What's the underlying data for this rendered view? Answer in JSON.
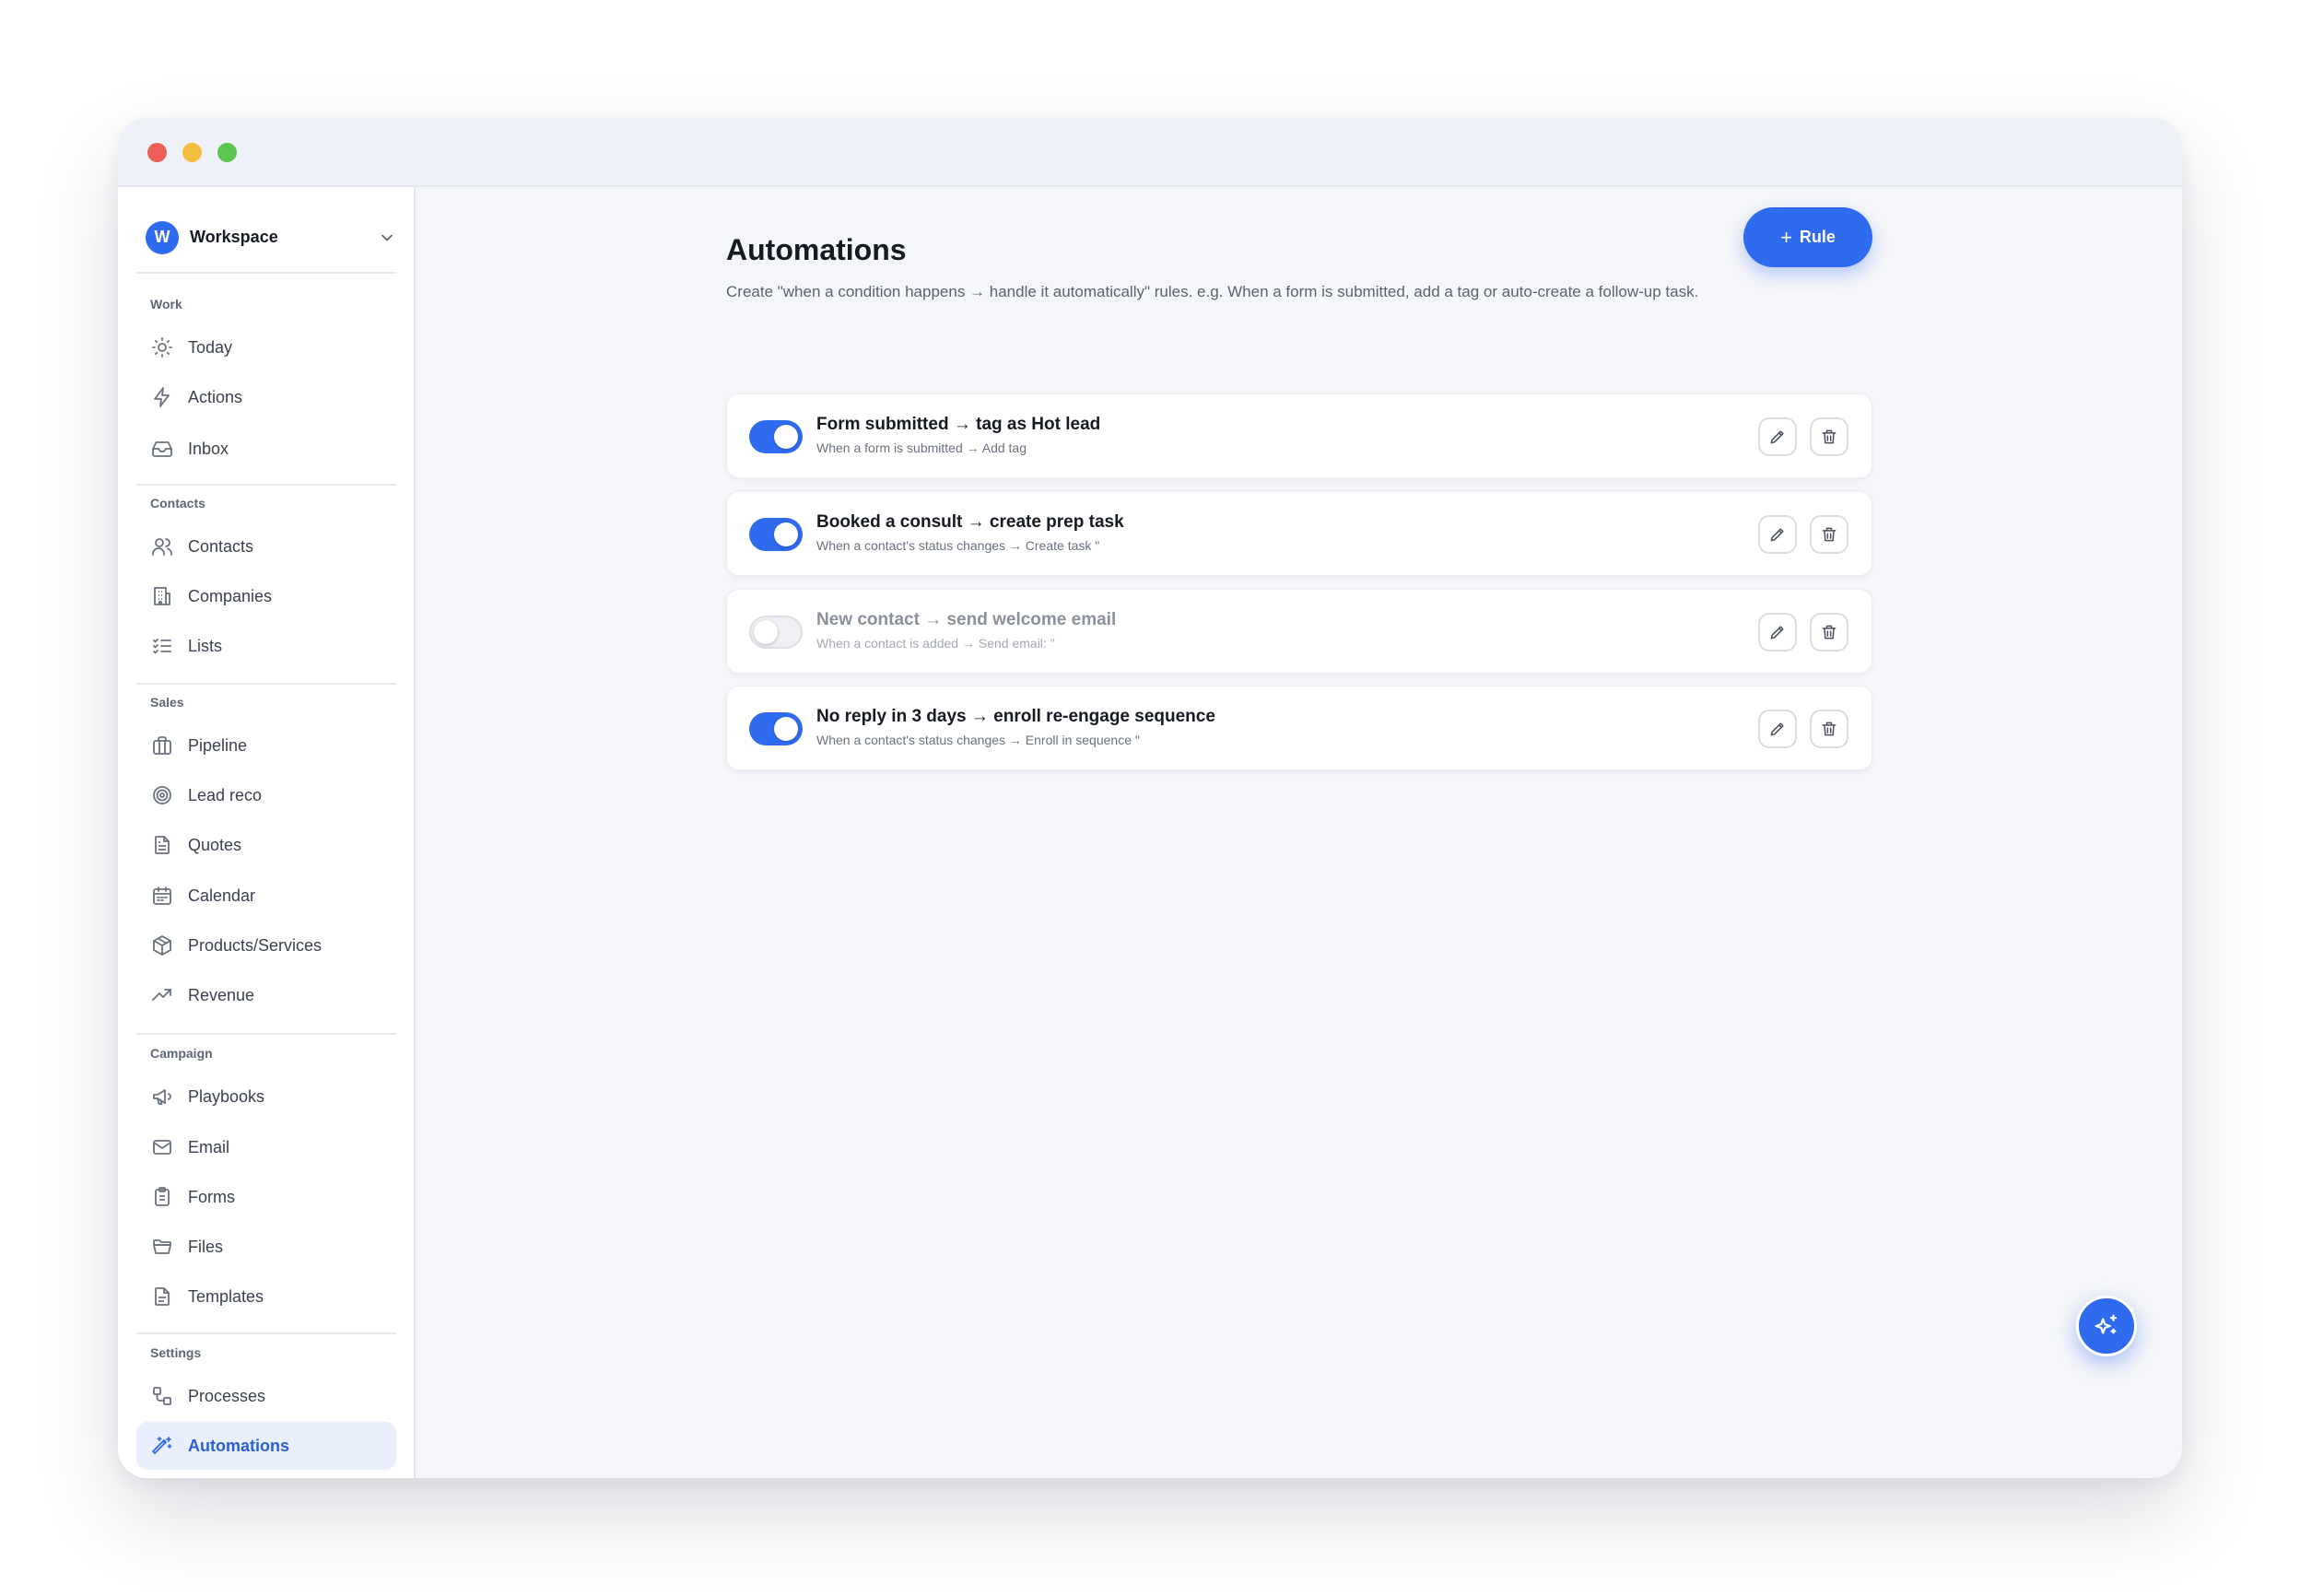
{
  "window": {
    "buttons": [
      "close",
      "minimize",
      "maximize"
    ]
  },
  "sidebar": {
    "workspace": {
      "initial": "W",
      "name": "Workspace"
    },
    "groups": [
      {
        "label": "Work",
        "items": [
          {
            "label": "Today",
            "icon": "sun-icon"
          },
          {
            "label": "Actions",
            "icon": "lightning-icon"
          },
          {
            "label": "Inbox",
            "icon": "inbox-icon"
          }
        ]
      },
      {
        "label": "Contacts",
        "items": [
          {
            "label": "Contacts",
            "icon": "users-icon"
          },
          {
            "label": "Companies",
            "icon": "building-icon"
          },
          {
            "label": "Lists",
            "icon": "checklist-icon"
          }
        ]
      },
      {
        "label": "Sales",
        "items": [
          {
            "label": "Pipeline",
            "icon": "briefcase-icon"
          },
          {
            "label": "Lead reco",
            "icon": "target-icon"
          },
          {
            "label": "Quotes",
            "icon": "document-icon"
          },
          {
            "label": "Calendar",
            "icon": "calendar-icon"
          },
          {
            "label": "Products/Services",
            "icon": "package-icon"
          },
          {
            "label": "Revenue",
            "icon": "trending-up-icon"
          }
        ]
      },
      {
        "label": "Campaign",
        "items": [
          {
            "label": "Playbooks",
            "icon": "megaphone-icon"
          },
          {
            "label": "Email",
            "icon": "mail-icon"
          },
          {
            "label": "Forms",
            "icon": "clipboard-icon"
          },
          {
            "label": "Files",
            "icon": "folder-icon"
          },
          {
            "label": "Templates",
            "icon": "template-icon"
          }
        ]
      },
      {
        "label": "Settings",
        "items": [
          {
            "label": "Processes",
            "icon": "workflow-icon"
          },
          {
            "label": "Automations",
            "icon": "magic-wand-icon",
            "active": true
          }
        ]
      }
    ]
  },
  "main": {
    "title": "Automations",
    "description": "Create \"when a condition happens → handle it automatically\" rules. e.g. When a form is submitted, add a tag or auto-create a follow-up task.",
    "add_button": {
      "icon": "+",
      "label": "Rule"
    },
    "rules": [
      {
        "enabled": true,
        "title": "Form submitted → tag as Hot lead",
        "subtitle": "When a form is submitted → Add tag"
      },
      {
        "enabled": true,
        "title": "Booked a consult → create prep task",
        "subtitle": "When a contact's status changes → Create task \""
      },
      {
        "enabled": false,
        "title": "New contact → send welcome email",
        "subtitle": "When a contact is added → Send email: \""
      },
      {
        "enabled": true,
        "title": "No reply in 3 days → enroll re-engage sequence",
        "subtitle": "When a contact's status changes → Enroll in sequence \""
      }
    ]
  },
  "fab": {
    "icon": "sparkles-icon"
  },
  "colors": {
    "accent": "#2f6bef",
    "active_nav_bg": "#e9effd",
    "app_bg": "#f5f6f9"
  }
}
